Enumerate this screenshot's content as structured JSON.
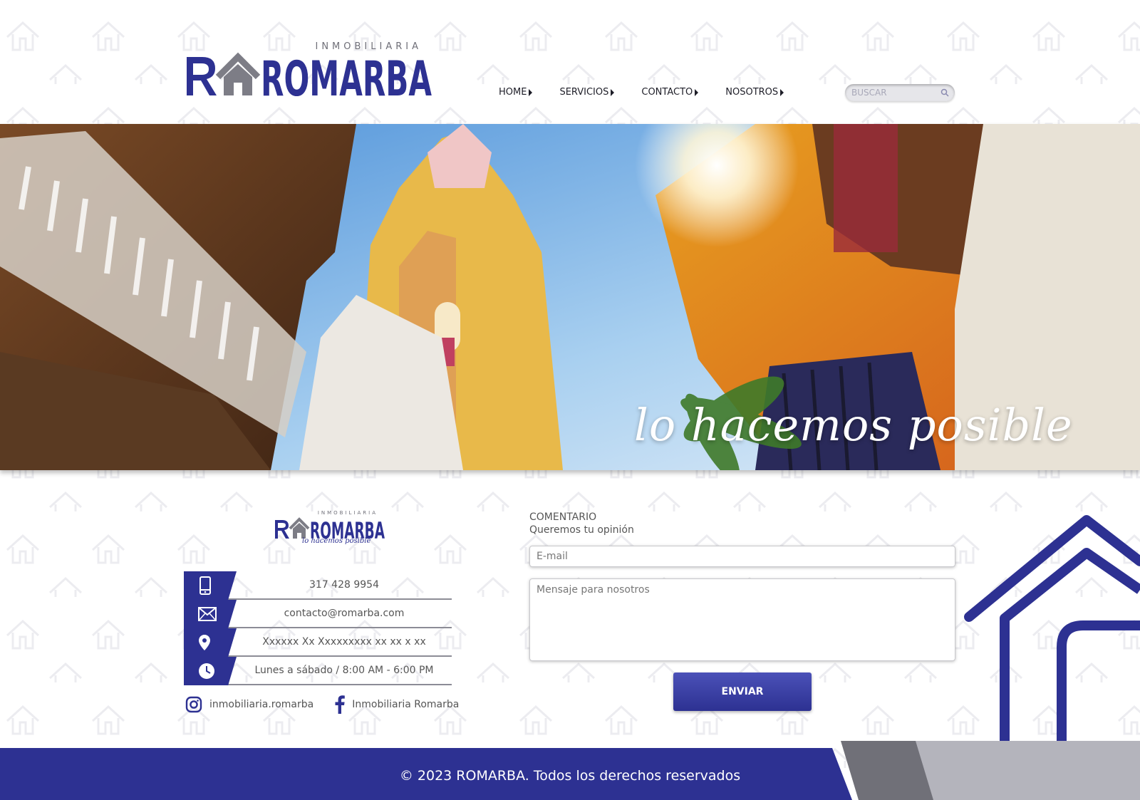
{
  "brand": {
    "name": "ROMARBA",
    "subtitle": "INMOBILIARIA",
    "tagline": "lo hacemos posible",
    "primary_color": "#2d3192"
  },
  "nav": {
    "items": [
      {
        "label": "HOME"
      },
      {
        "label": "SERVICIOS"
      },
      {
        "label": "CONTACTO"
      },
      {
        "label": "NOSOTROS"
      }
    ]
  },
  "search": {
    "placeholder": "BUSCAR"
  },
  "hero": {
    "tagline": "lo hacemos posible"
  },
  "contact": {
    "phone": "317 428 9954",
    "email": "contacto@romarba.com",
    "address": "Xxxxxx Xx Xxxxxxxxx xx xx x xx",
    "hours": "Lunes a sábado / 8:00 AM - 6:00 PM",
    "instagram": "inmobiliaria.romarba",
    "facebook": "Inmobiliaria Romarba"
  },
  "form": {
    "title": "COMENTARIO",
    "subtitle": "Queremos tu opinión",
    "email_placeholder": "E-mail",
    "message_placeholder": "Mensaje para nosotros",
    "submit_label": "ENVIAR"
  },
  "footer": {
    "copyright": "© 2023 ROMARBA. Todos los derechos reservados"
  }
}
